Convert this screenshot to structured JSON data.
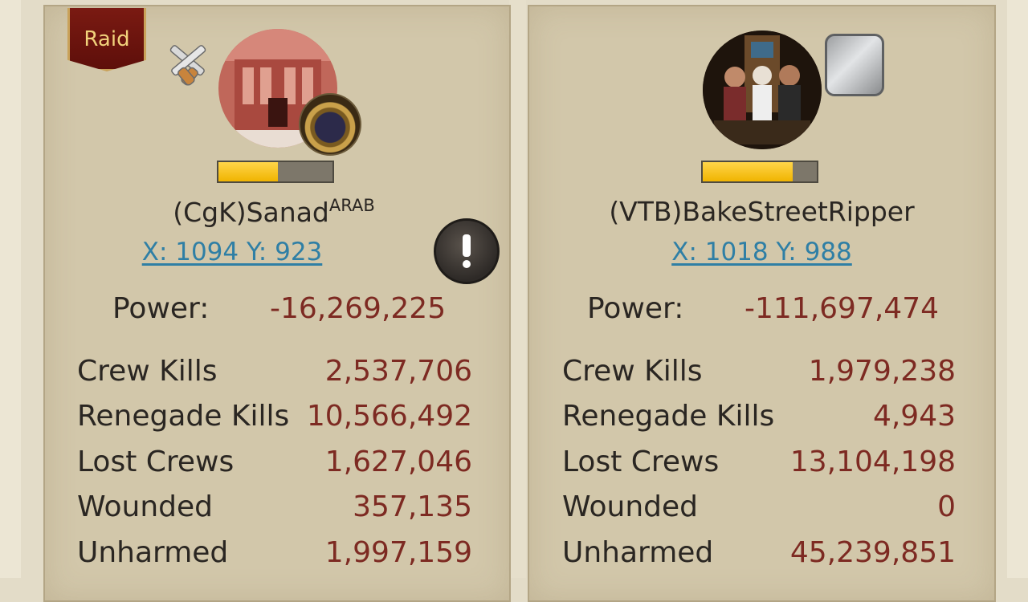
{
  "attacker": {
    "raid_badge": "Raid",
    "name": "(CgK)Sanad",
    "name_suffix": "ARAB",
    "coords": "X: 1094 Y: 923",
    "health_fraction": 0.52,
    "power_label": "Power:",
    "power_value": "-16,269,225",
    "stats": [
      {
        "label": "Crew Kills",
        "value": "2,537,706"
      },
      {
        "label": "Renegade Kills",
        "value": "10,566,492"
      },
      {
        "label": "Lost Crews",
        "value": "1,627,046"
      },
      {
        "label": "Wounded",
        "value": "357,135"
      },
      {
        "label": "Unharmed",
        "value": "1,997,159"
      }
    ]
  },
  "defender": {
    "name": "(VTB)BakeStreetRipper",
    "coords": "X: 1018 Y: 988",
    "health_fraction": 0.79,
    "power_label": "Power:",
    "power_value": "-111,697,474",
    "stats": [
      {
        "label": "Crew Kills",
        "value": "1,979,238"
      },
      {
        "label": "Renegade Kills",
        "value": "4,943"
      },
      {
        "label": "Lost Crews",
        "value": "13,104,198"
      },
      {
        "label": "Wounded",
        "value": "0"
      },
      {
        "label": "Unharmed",
        "value": "45,239,851"
      }
    ]
  },
  "colors": {
    "panel": "#d2c7aa",
    "value_red": "#7d2a22",
    "link_blue": "#2f7fa5",
    "bar_yellow": "#f0b400",
    "badge_red": "#7a1a12"
  },
  "icons": [
    "crossed-pistols-icon",
    "gray-frame-icon",
    "alert-icon",
    "alliance-emblem-icon"
  ]
}
